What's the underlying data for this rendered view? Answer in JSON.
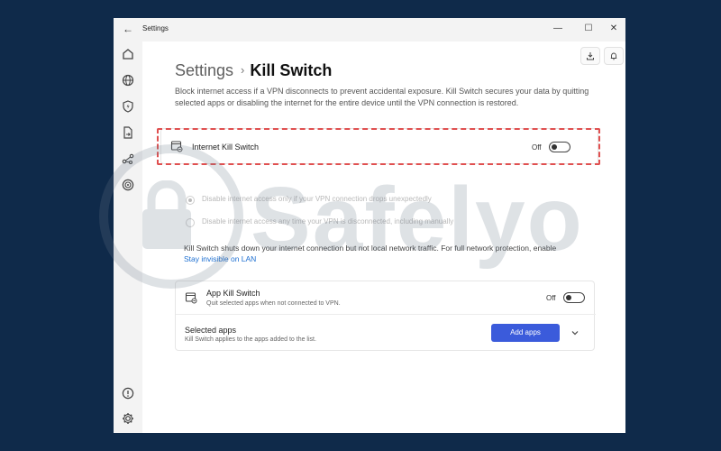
{
  "window": {
    "title": "Settings",
    "back_glyph": "←",
    "minimize_glyph": "—",
    "maximize_glyph": "☐",
    "close_glyph": "✕"
  },
  "sidebar": {
    "items": [
      {
        "icon": "home-icon"
      },
      {
        "icon": "globe-icon"
      },
      {
        "icon": "shield-bolt-icon"
      },
      {
        "icon": "file-arrow-icon"
      },
      {
        "icon": "meshnet-icon"
      },
      {
        "icon": "target-icon"
      }
    ],
    "bottom_items": [
      {
        "icon": "help-chat-icon"
      },
      {
        "icon": "settings-gear-icon",
        "active": true
      }
    ],
    "active_color": "#1d6fd1"
  },
  "toolbar": {
    "download_icon": "download-icon",
    "bell_icon": "bell-icon"
  },
  "breadcrumb": {
    "parent": "Settings",
    "separator": "›",
    "current": "Kill Switch"
  },
  "description": "Block internet access if a VPN disconnects to prevent accidental exposure. Kill Switch secures your data by quitting selected apps or disabling the internet for the entire device until the VPN connection is restored.",
  "internet_kill_switch": {
    "title": "Internet Kill Switch",
    "state": "Off",
    "highlight_color": "#e05050",
    "options": [
      {
        "label": "Disable internet access only if your VPN connection drops unexpectedly",
        "selected": true
      },
      {
        "label": "Disable internet access any time your VPN is disconnected, including manually",
        "selected": false
      }
    ]
  },
  "note": {
    "text": "Kill Switch shuts down your internet connection but not local network traffic. For full network protection, enable",
    "link": "Stay invisible on LAN"
  },
  "app_kill_switch": {
    "title": "App Kill Switch",
    "subtitle": "Quit selected apps when not connected to VPN.",
    "state": "Off",
    "selected_apps_title": "Selected apps",
    "selected_apps_subtitle": "Kill Switch applies to the apps added to the list.",
    "add_button": "Add apps",
    "button_color": "#3b5bdb"
  },
  "watermark": {
    "text": "Safelyo"
  }
}
